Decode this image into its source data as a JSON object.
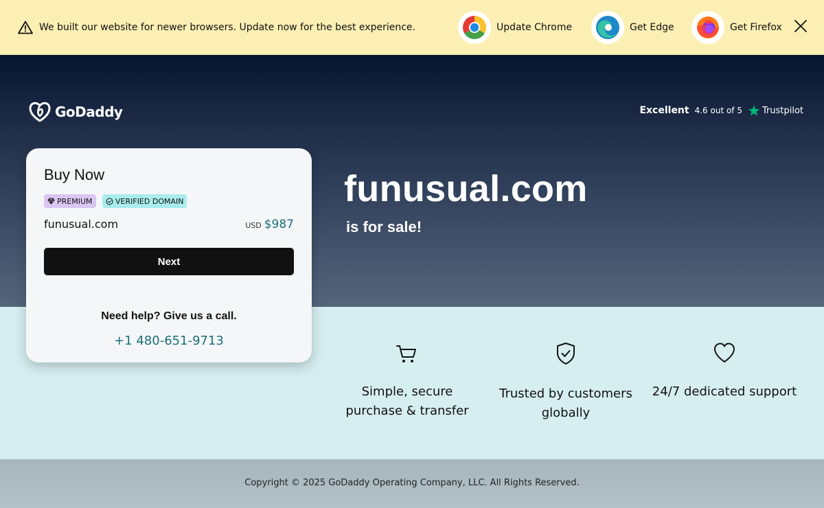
{
  "banner": {
    "message": "We built our website for newer browsers. Update now for the best experience.",
    "browsers": [
      {
        "label": "Update Chrome",
        "icon": "chrome-icon"
      },
      {
        "label": "Get Edge",
        "icon": "edge-icon"
      },
      {
        "label": "Get Firefox",
        "icon": "firefox-icon"
      }
    ],
    "background": "#fcefb4"
  },
  "header": {
    "logo_text": "GoDaddy",
    "trustpilot": {
      "excellent": "Excellent",
      "rating": "4.6 out of 5",
      "brand": "Trustpilot"
    }
  },
  "hero": {
    "domain": "funusual.com",
    "tagline": "is for sale!"
  },
  "card": {
    "title": "Buy Now",
    "badges": {
      "premium": "PREMIUM",
      "verified": "VERIFIED DOMAIN"
    },
    "domain": "funusual.com",
    "currency": "USD",
    "price": "$987",
    "next_label": "Next",
    "help_text": "Need help? Give us a call.",
    "phone": "+1 480-651-9713"
  },
  "features": [
    {
      "icon": "cart-icon",
      "text_line1": "Simple, secure",
      "text_line2": "purchase & transfer"
    },
    {
      "icon": "shield-check-icon",
      "text_line1": "Trusted by customers",
      "text_line2": "globally"
    },
    {
      "icon": "heart-icon",
      "text_line1": "24/7 dedicated support",
      "text_line2": ""
    }
  ],
  "footer": {
    "copyright": "Copyright © 2025 GoDaddy Operating Company, LLC. All Rights Reserved."
  },
  "colors": {
    "accent_teal": "#1c6e78",
    "features_bg": "#d6eef0",
    "trustpilot_green": "#00b67a"
  }
}
